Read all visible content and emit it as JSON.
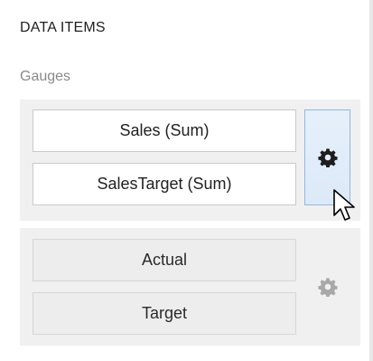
{
  "section": {
    "title": "DATA ITEMS"
  },
  "gauges": {
    "label": "Gauges",
    "assigned": {
      "items": [
        "Sales (Sum)",
        "SalesTarget (Sum)"
      ],
      "options_icon": "gear-icon",
      "options_state": "hover"
    },
    "placeholder": {
      "items": [
        "Actual",
        "Target"
      ],
      "options_icon": "gear-icon",
      "options_state": "disabled"
    }
  },
  "colors": {
    "group_background": "#f0f0f0",
    "hover_border": "#92b7e0",
    "hover_fill": "#e1ecf9",
    "active_gear": "#1e1e1e",
    "disabled_gear": "#a8a8a8",
    "muted_label": "#8a8a8a"
  }
}
